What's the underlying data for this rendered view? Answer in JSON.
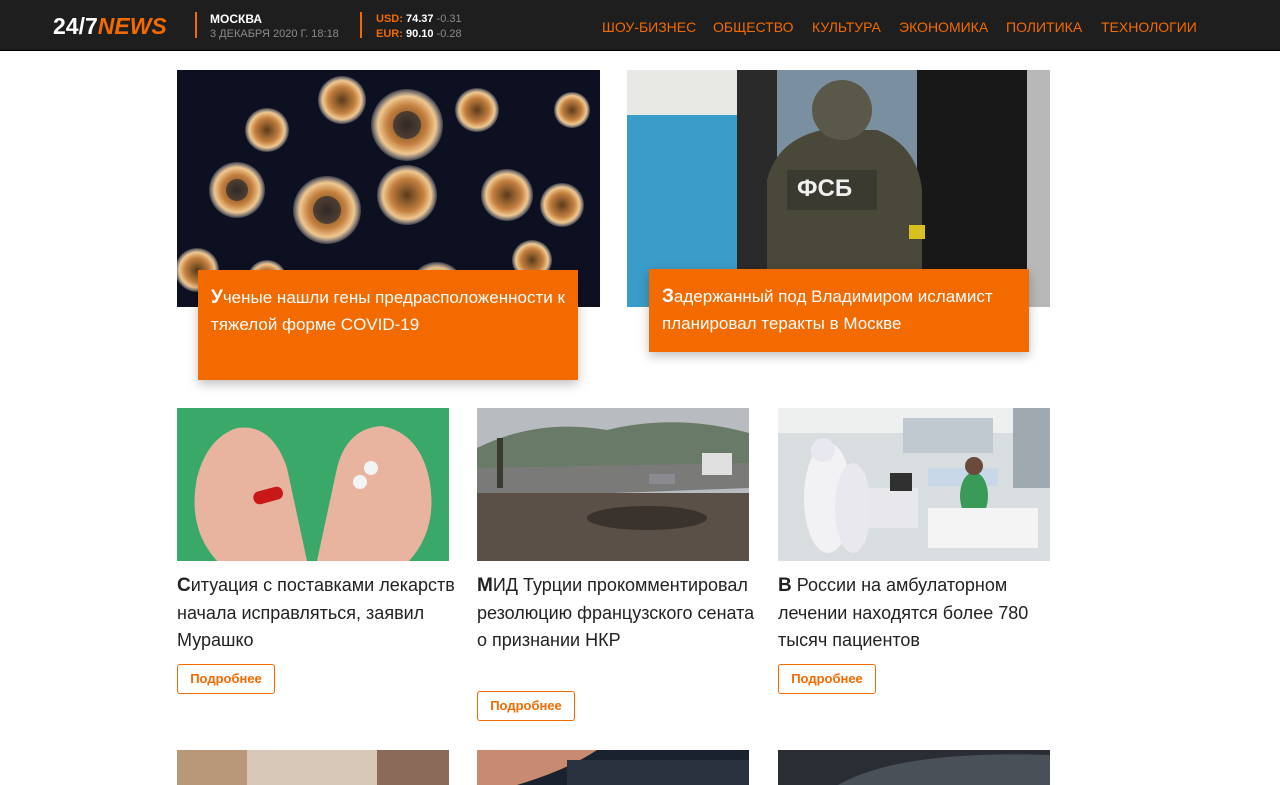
{
  "header": {
    "logo_prefix": "24/7",
    "logo_suffix": "NEWS",
    "city": "МОСКВА",
    "date": "3 ДЕКАБРЯ 2020 Г. 18:18",
    "currencies": [
      {
        "code": "USD:",
        "value": "74.37",
        "change": "-0.31"
      },
      {
        "code": "EUR:",
        "value": "90.10",
        "change": "-0.28"
      }
    ],
    "nav": [
      "ШОУ-БИЗНЕС",
      "ОБЩЕСТВО",
      "КУЛЬТУРА",
      "ЭКОНОМИКА",
      "ПОЛИТИКА",
      "ТЕХНОЛОГИИ"
    ]
  },
  "hero": [
    {
      "first_letter": "У",
      "rest": "ченые нашли гены предрасположенности к тяжелой форме COVID-19",
      "image": "coronavirus-microscope-photo"
    },
    {
      "first_letter": "З",
      "rest": "адержанный под Владимиром исламист планировал теракты в Москве",
      "image": "fsb-officer-photo"
    }
  ],
  "cards": [
    {
      "first_letter": "С",
      "rest": "итуация с поставками лекарств начала исправляться, заявил Мурашко",
      "button": "Подробнее",
      "image": "pills-in-hands-photo"
    },
    {
      "first_letter": "М",
      "rest": "ИД Турции прокомментировал резолюцию французского сената о признании НКР",
      "button": "Подробнее",
      "image": "damaged-road-photo"
    },
    {
      "first_letter": "В",
      "rest": " России на амбулаторном лечении находятся более 780 тысяч пациентов",
      "button": "Подробнее",
      "image": "hospital-ward-photo"
    }
  ],
  "colors": {
    "accent": "#f26a00",
    "header_bg": "#1e1e1e"
  }
}
